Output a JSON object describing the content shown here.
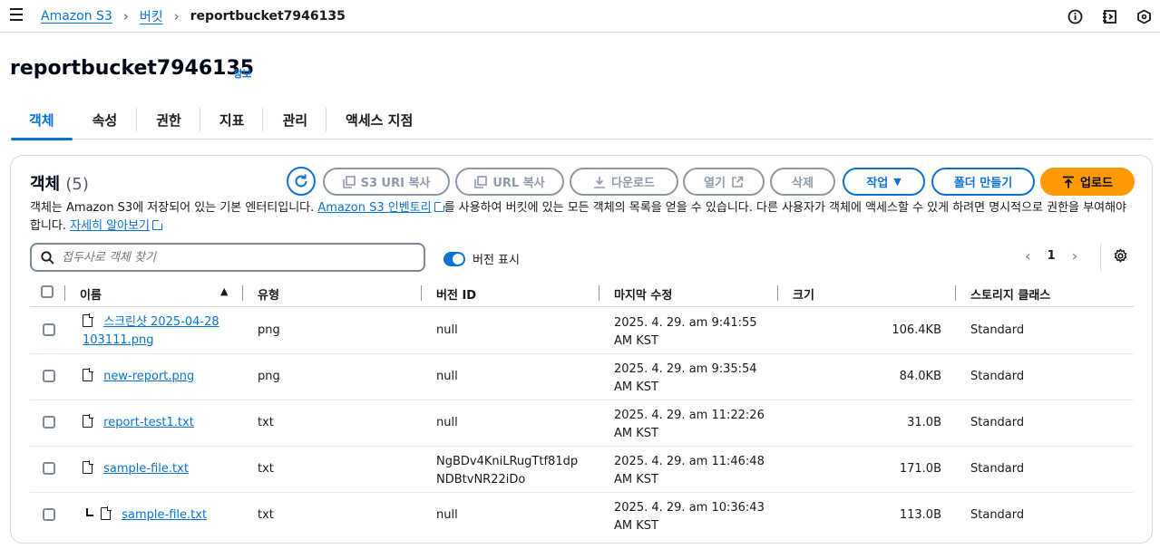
{
  "breadcrumb": {
    "root": "Amazon S3",
    "buckets": "버킷",
    "current": "reportbucket7946135"
  },
  "page": {
    "title": "reportbucket7946135",
    "info": "정보"
  },
  "tabs": [
    "객체",
    "속성",
    "권한",
    "지표",
    "관리",
    "액세스 지점"
  ],
  "objects": {
    "title": "객체",
    "count": "(5)",
    "buttons": {
      "copy_s3_uri": "S3 URI 복사",
      "copy_url": "URL 복사",
      "download": "다운로드",
      "open": "열기",
      "delete": "삭제",
      "actions": "작업",
      "create_folder": "폴더 만들기",
      "upload": "업로드"
    },
    "description": {
      "part1": "객체는 Amazon S3에 저장되어 있는 기본 엔터티입니다. ",
      "link1": "Amazon S3 인벤토리",
      "part2": "를 사용하여 버킷에 있는 모든 객체의 목록을 얻을 수 있습니다. 다른 사용자가 객체에 액세스할 수 있게 하려면 명시적으로 권한을 부여해야 합니다. ",
      "link2": "자세히 알아보기"
    },
    "search_placeholder": "접두사로 객체 찾기",
    "show_versions_label": "버전 표시",
    "show_versions": true,
    "page_number": "1",
    "columns": [
      "이름",
      "유형",
      "버전 ID",
      "마지막 수정",
      "크기",
      "스토리지 클래스"
    ],
    "rows": [
      {
        "name": "스크린샷 2025-04-28 103111.png",
        "type": "png",
        "version_id": "null",
        "modified": "2025. 4. 29. am 9:41:55 AM KST",
        "size": "106.4KB",
        "storage": "Standard"
      },
      {
        "name": "new-report.png",
        "type": "png",
        "version_id": "null",
        "modified": "2025. 4. 29. am 9:35:54 AM KST",
        "size": "84.0KB",
        "storage": "Standard"
      },
      {
        "name": "report-test1.txt",
        "type": "txt",
        "version_id": "null",
        "modified": "2025. 4. 29. am 11:22:26 AM KST",
        "size": "31.0B",
        "storage": "Standard"
      },
      {
        "name": "sample-file.txt",
        "type": "txt",
        "version_id": "NgBDv4KniLRugTtf81dpNDBtvNR22iDo",
        "modified": "2025. 4. 29. am 11:46:48 AM KST",
        "size": "171.0B",
        "storage": "Standard"
      },
      {
        "name": "sample-file.txt",
        "type": "txt",
        "version_id": "null",
        "modified": "2025. 4. 29. am 10:36:43 AM KST",
        "size": "113.0B",
        "storage": "Standard"
      }
    ]
  },
  "colors": {
    "link": "#0972d3",
    "primary": "#ff9900",
    "border": "#d5dbdb",
    "disabled": "#8d99a8"
  }
}
